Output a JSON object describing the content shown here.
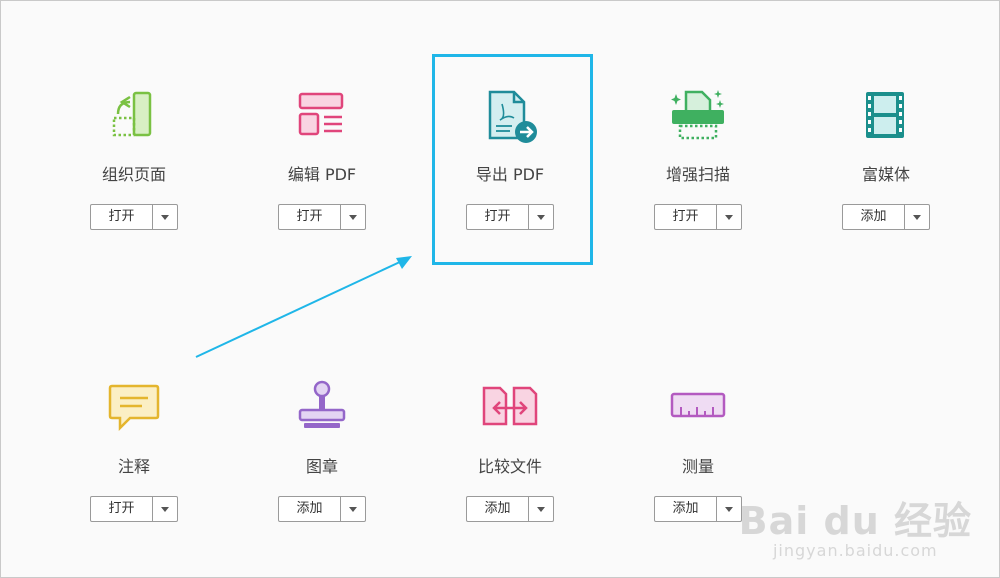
{
  "tools": [
    {
      "id": "organize",
      "label": "组织页面",
      "button": "打开",
      "icon": "organize-pages-icon",
      "color": "#7ac143"
    },
    {
      "id": "edit",
      "label": "编辑 PDF",
      "button": "打开",
      "icon": "edit-pdf-icon",
      "color": "#e0457b"
    },
    {
      "id": "export",
      "label": "导出 PDF",
      "button": "打开",
      "icon": "export-pdf-icon",
      "color": "#1f8c9a"
    },
    {
      "id": "enhance",
      "label": "增强扫描",
      "button": "打开",
      "icon": "enhance-scan-icon",
      "color": "#3fb060"
    },
    {
      "id": "richmedia",
      "label": "富媒体",
      "button": "添加",
      "icon": "rich-media-icon",
      "color": "#1b8f8c"
    },
    {
      "id": "comment",
      "label": "注释",
      "button": "打开",
      "icon": "comment-icon",
      "color": "#e4b52d"
    },
    {
      "id": "stamp",
      "label": "图章",
      "button": "添加",
      "icon": "stamp-icon",
      "color": "#9466c9"
    },
    {
      "id": "compare",
      "label": "比较文件",
      "button": "添加",
      "icon": "compare-files-icon",
      "color": "#e0457b"
    },
    {
      "id": "measure",
      "label": "测量",
      "button": "添加",
      "icon": "measure-icon",
      "color": "#b35ac0"
    }
  ],
  "highlight_color": "#1fb6e8",
  "watermark": {
    "brand": "Bai du 经验",
    "url": "jingyan.baidu.com"
  }
}
